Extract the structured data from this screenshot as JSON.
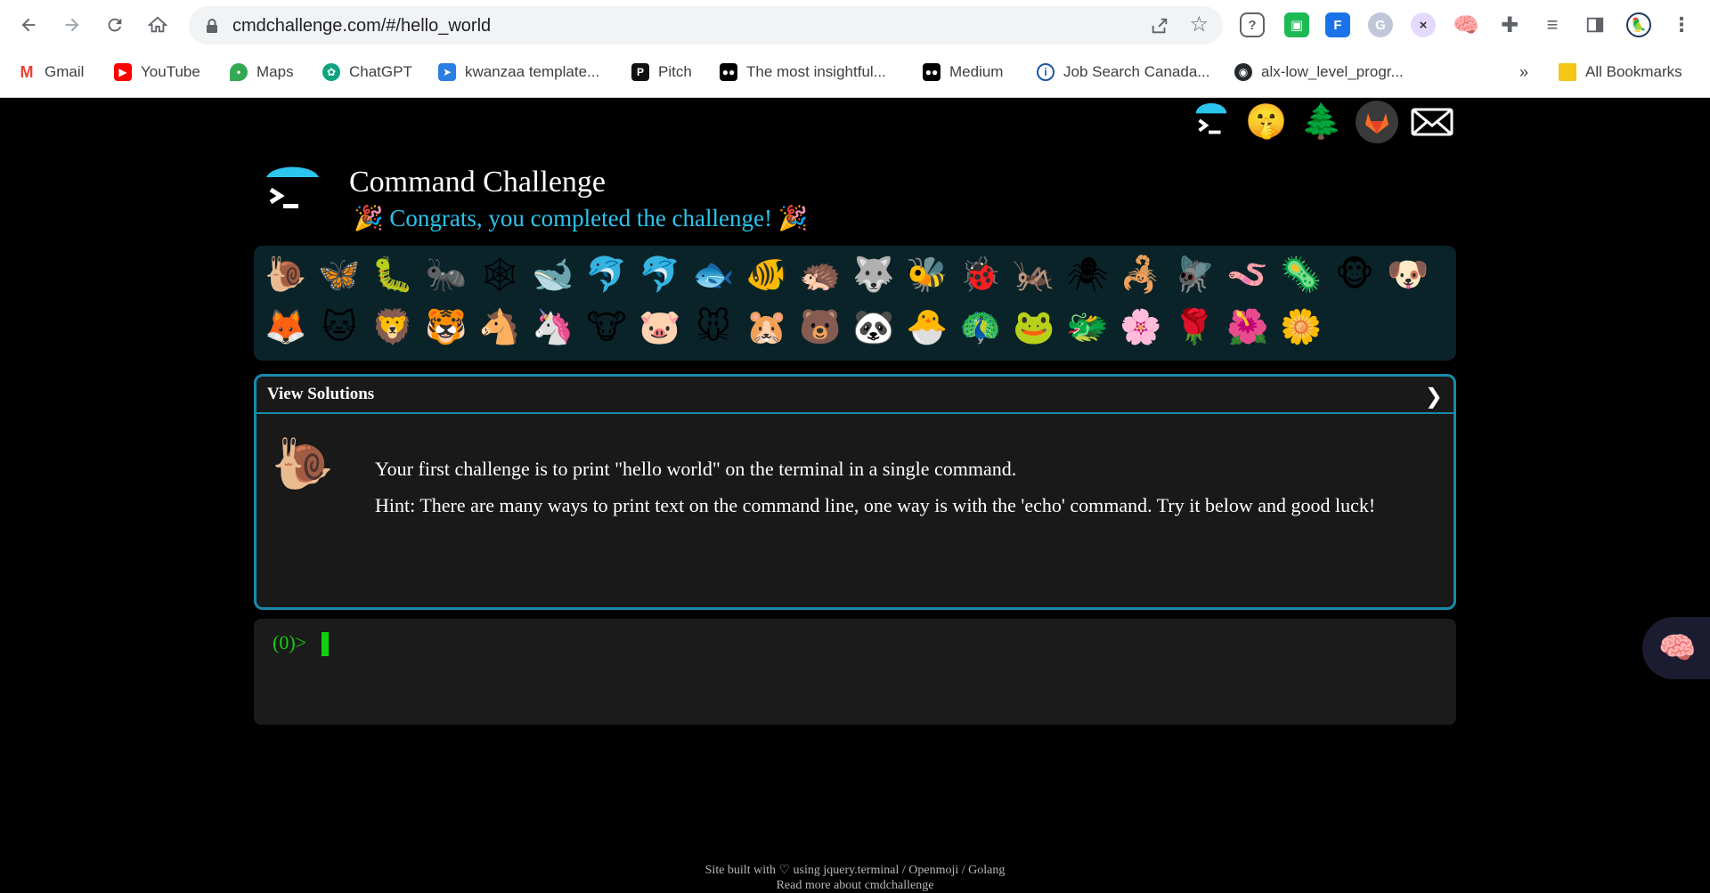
{
  "browser": {
    "url": "cmdchallenge.com/#/hello_world",
    "bookmarks": [
      {
        "label": "Gmail",
        "icon": "gmail-icon",
        "color": "#ea4335"
      },
      {
        "label": "YouTube",
        "icon": "youtube-icon",
        "color": "#ff0000"
      },
      {
        "label": "Maps",
        "icon": "maps-icon",
        "color": "#34a853"
      },
      {
        "label": "ChatGPT",
        "icon": "chatgpt-icon",
        "color": "#10a37f"
      },
      {
        "label": "kwanzaa template...",
        "icon": "kwanzaa-icon",
        "color": "#2a7de1"
      },
      {
        "label": "Pitch",
        "icon": "pitch-icon",
        "color": "#111111"
      },
      {
        "label": "The most insightful...",
        "icon": "medium-icon",
        "color": "#000000"
      },
      {
        "label": "Medium",
        "icon": "medium-icon",
        "color": "#000000"
      },
      {
        "label": "Job Search Canada...",
        "icon": "info-icon",
        "color": "#1a56a5"
      },
      {
        "label": "alx-low_level_progr...",
        "icon": "github-icon",
        "color": "#24292e"
      }
    ],
    "overflow": "»",
    "all_bookmarks": "All Bookmarks"
  },
  "site": {
    "title": "Command Challenge",
    "congrats_prefix": "🎉",
    "congrats": "Congrats, you completed the challenge!",
    "congrats_suffix": "🎉",
    "top_icons": [
      "terminal-logo",
      "shushing-face",
      "christmas-tree",
      "gitlab",
      "mail"
    ]
  },
  "badges": [
    [
      "🐌",
      "🦋",
      "🐛",
      "🐜",
      "🕸",
      "🐋",
      "🐬",
      "🐬",
      "🐟",
      "🐠",
      "🦔",
      "🐺",
      "🐝",
      "🐞",
      "🦗",
      "🕷",
      "🦂",
      "🪰",
      "🪱",
      "🦠",
      "🐵",
      "🐶"
    ],
    [
      "🦊",
      "🐱",
      "🦁",
      "🐯",
      "🐴",
      "🦄",
      "🐮",
      "🐷",
      "🐭",
      "🐹",
      "🐻",
      "🐼",
      "🐣",
      "🦚",
      "🐸",
      "🐲",
      "🌸",
      "🌹",
      "🌺",
      "🌼"
    ]
  ],
  "panel": {
    "header": "View Solutions",
    "chevron": "❯",
    "icon": "🐌",
    "paragraph1": "Your first challenge is to print \"hello world\" on the terminal in a single command.",
    "paragraph2": "Hint: There are many ways to print text on the command line, one way is with the 'echo' command. Try it below and good luck!"
  },
  "terminal": {
    "prompt": "(0)>"
  },
  "footer": {
    "line1": "Site built with ♡ using jquery.terminal / Openmoji / Golang",
    "line2": "Read more about cmdchallenge"
  }
}
